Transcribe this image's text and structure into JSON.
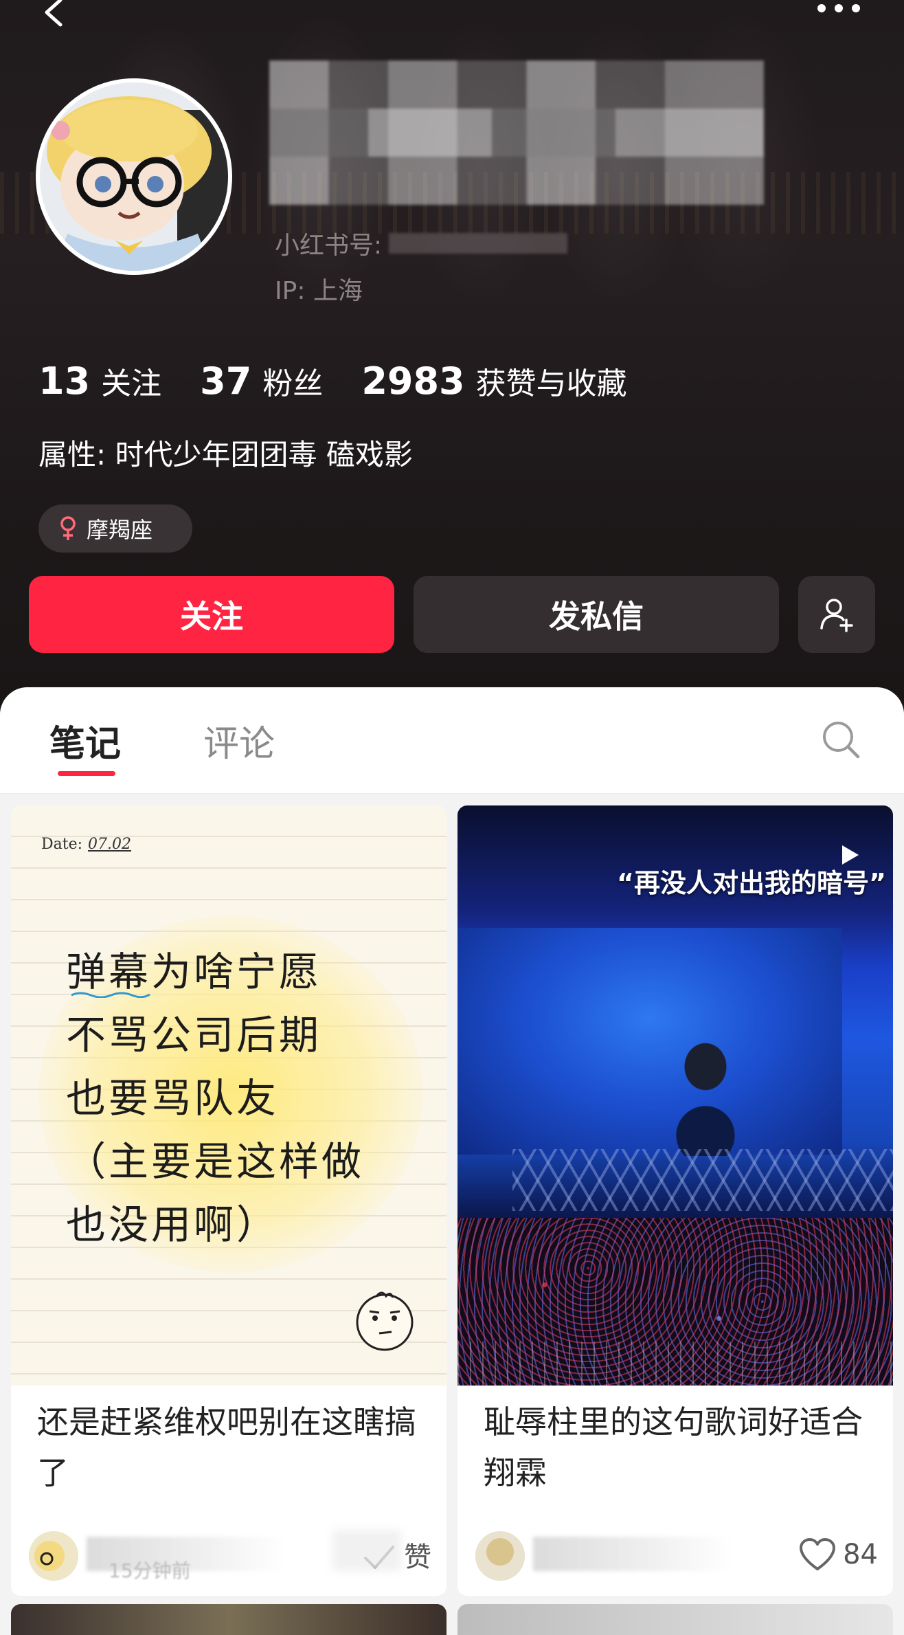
{
  "header": {
    "xhs_id_label": "小红书号:",
    "ip_label": "IP: 上海",
    "stats": [
      {
        "num": "13",
        "label": "关注"
      },
      {
        "num": "37",
        "label": "粉丝"
      },
      {
        "num": "2983",
        "label": "获赞与收藏"
      }
    ],
    "attribute": "属性: 时代少年团团毒  磕戏影",
    "zodiac": "摩羯座",
    "follow_label": "关注",
    "message_label": "发私信"
  },
  "tabs": {
    "notes": "笔记",
    "comments": "评论"
  },
  "cards": [
    {
      "date_label": "Date:",
      "date_value": "07.02",
      "handwriting": [
        "弹幕为啥宁愿",
        "不骂公司后期",
        "也要骂队友",
        "（主要是这样做",
        "也没用啊）"
      ],
      "title": "还是赶紧维权吧别在这瞎搞了",
      "time": "15分钟前",
      "like_text": "赞"
    },
    {
      "video_caption": "“再没人对出我的暗号”",
      "title": "耻辱柱里的这句歌词好适合翔霖",
      "like_count": "84"
    }
  ],
  "colors": {
    "accent": "#ff2442",
    "header_bg": "#1f1a1c",
    "button_dark": "#352e30"
  },
  "icons": [
    "back-icon",
    "more-icon",
    "female-icon",
    "add-user-icon",
    "search-icon",
    "heart-icon",
    "play-icon"
  ]
}
